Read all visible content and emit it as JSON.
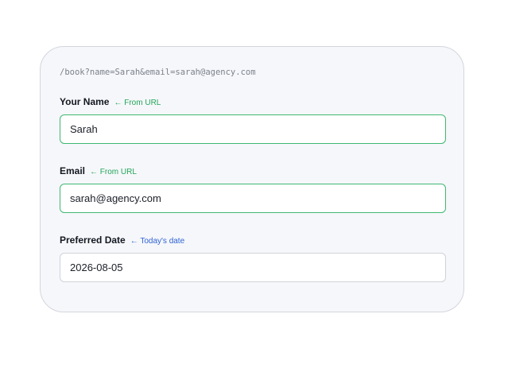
{
  "url_preview": "/book?name=Sarah&email=sarah@agency.com",
  "fields": [
    {
      "label": "Your Name",
      "hint": "← From URL",
      "value": "Sarah",
      "source": "url"
    },
    {
      "label": "Email",
      "hint": "← From URL",
      "value": "sarah@agency.com",
      "source": "url"
    },
    {
      "label": "Preferred Date",
      "hint": "← Today's date",
      "value": "2026-08-05",
      "source": "default"
    }
  ],
  "colors": {
    "url_hint": "#22a55a",
    "default_hint": "#2f62d6",
    "prefilled_border": "#3fb871"
  }
}
